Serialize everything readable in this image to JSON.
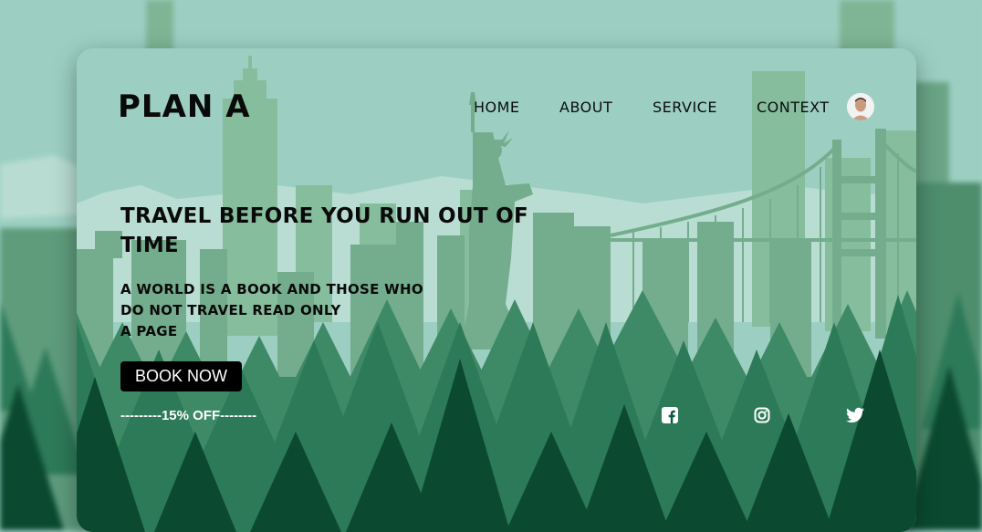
{
  "brand": {
    "logo": "PLAN A"
  },
  "nav": {
    "items": [
      {
        "label": "HOME"
      },
      {
        "label": "ABOUT"
      },
      {
        "label": "SERVICE"
      },
      {
        "label": "CONTEXT"
      }
    ]
  },
  "hero": {
    "title": "TRAVEL BEFORE YOU RUN OUT OF TIME",
    "subtitle_lines": [
      "A WORLD IS A BOOK AND THOSE WHO",
      "DO NOT TRAVEL READ ONLY",
      "A PAGE"
    ],
    "cta_label": "BOOK NOW",
    "offer_text": "---------15% OFF--------"
  },
  "social": {
    "icons": [
      "facebook-icon",
      "instagram-icon",
      "twitter-icon"
    ]
  },
  "colors": {
    "sky": "#9ccfc2",
    "far_buildings": "#7fb595",
    "near_buildings": "#6aa586",
    "forest_far": "#2d7a58",
    "forest_near": "#0b4a31",
    "button": "#000000",
    "text_dark": "#0a0a0a",
    "text_light": "#ffffff"
  }
}
